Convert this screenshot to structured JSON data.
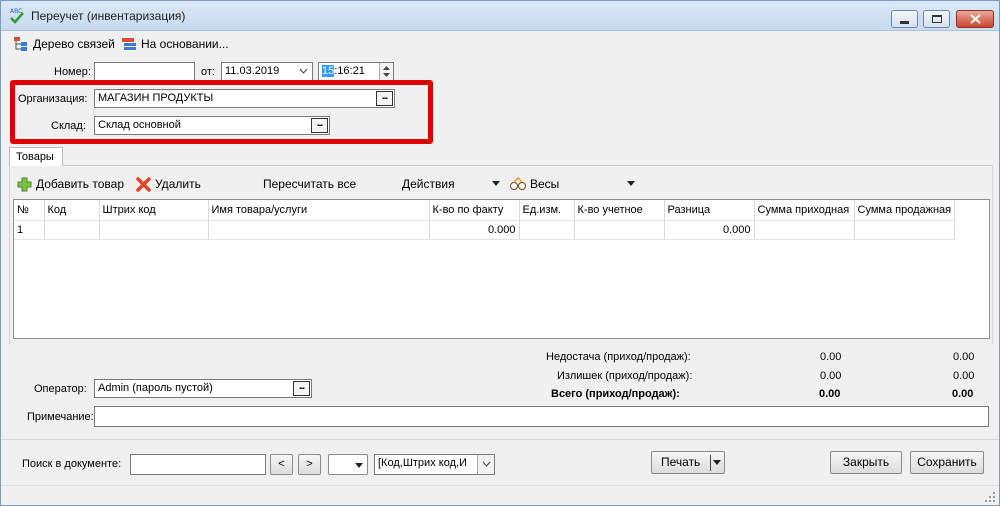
{
  "window": {
    "title": "Переучет (инвентаризация)"
  },
  "toolbar": {
    "tree_label": "Дерево связей",
    "based_on_label": "На основании..."
  },
  "header": {
    "number_label": "Номер:",
    "number_value": "",
    "date_label": "от:",
    "date_value": "11.03.2019",
    "time_hour": "15",
    "time_rest": ":16:21",
    "org_label": "Организация:",
    "org_value": "МАГАЗИН ПРОДУКТЫ",
    "warehouse_label": "Склад:",
    "warehouse_value": "Склад основной",
    "ellipsis": "..."
  },
  "tabs": {
    "goods": "Товары"
  },
  "goods_toolbar": {
    "add": "Добавить товар",
    "delete": "Удалить",
    "recalc": "Пересчитать все",
    "actions": "Действия",
    "scales": "Весы"
  },
  "table": {
    "columns": [
      "№",
      "Код",
      "Штрих код",
      "Имя товара/услуги",
      "К-во по факту",
      "Ед.изм.",
      "К-во учетное",
      "Разница",
      "Сумма приходная",
      "Сумма продажная"
    ],
    "rows": [
      [
        "1",
        "",
        "",
        "",
        "0.000",
        "",
        "",
        "0.000",
        "",
        ""
      ]
    ]
  },
  "totals": {
    "shortage_label": "Недостача (приход/продаж):",
    "shortage_in": "0.00",
    "shortage_sale": "0.00",
    "surplus_label": "Излишек (приход/продаж):",
    "surplus_in": "0.00",
    "surplus_sale": "0.00",
    "total_label": "Всего (приход/продаж):",
    "total_in": "0.00",
    "total_sale": "0.00"
  },
  "operator": {
    "label": "Оператор:",
    "value": "Admin (пароль пустой)"
  },
  "note": {
    "label": "Примечание:",
    "value": ""
  },
  "footer": {
    "search_label": "Поиск в документе:",
    "search_value": "",
    "prev": "<",
    "next": ">",
    "search_fields": "[Код,Штрих код,И",
    "print": "Печать",
    "close": "Закрыть",
    "save": "Сохранить"
  }
}
